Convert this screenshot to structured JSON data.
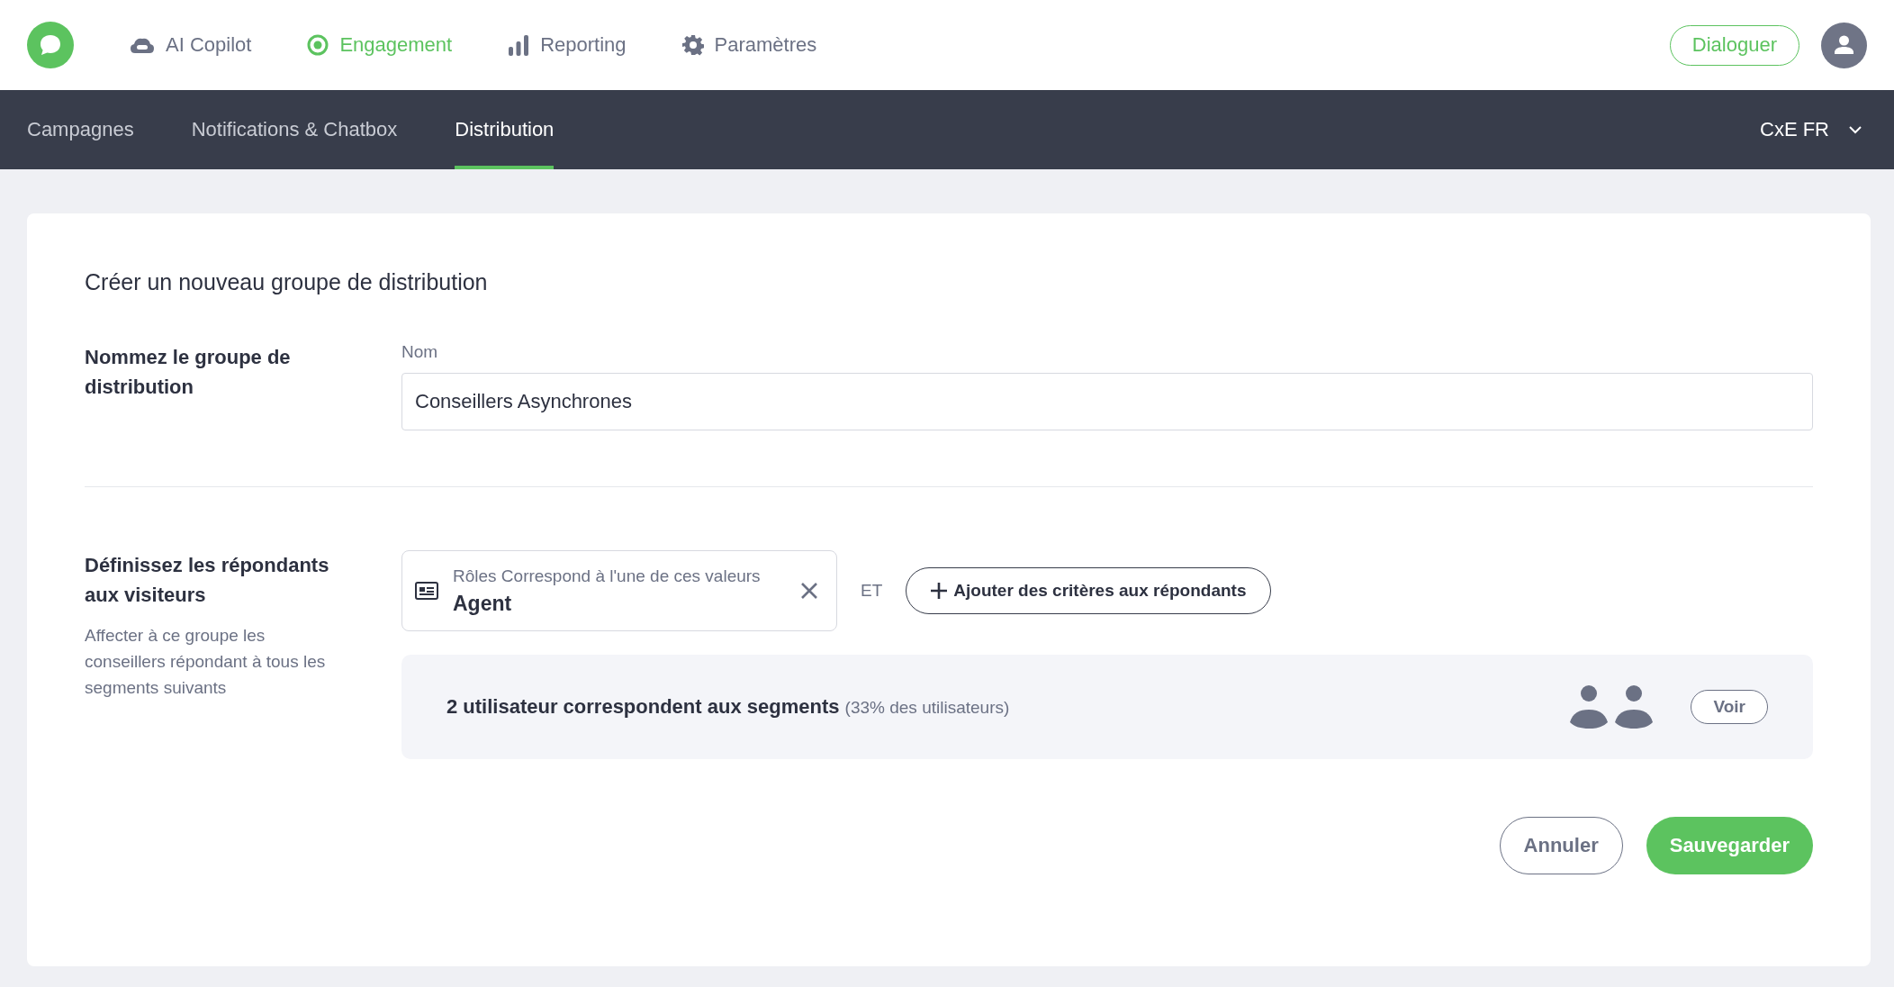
{
  "top_nav": {
    "items": [
      {
        "kind": "copilot",
        "label": "AI Copilot",
        "selected": false
      },
      {
        "kind": "engagement",
        "label": "Engagement",
        "selected": true
      },
      {
        "kind": "reporting",
        "label": "Reporting",
        "selected": false
      },
      {
        "kind": "settings",
        "label": "Paramètres",
        "selected": false
      }
    ],
    "cta": "Dialoguer"
  },
  "sub_nav": {
    "tabs": [
      {
        "label": "Campagnes",
        "selected": false
      },
      {
        "label": "Notifications & Chatbox",
        "selected": false
      },
      {
        "label": "Distribution",
        "selected": true
      }
    ],
    "workspace": "CxE FR"
  },
  "form": {
    "title": "Créer un nouveau groupe de distribution",
    "name_section": {
      "heading": "Nommez le groupe de distribution",
      "field_label": "Nom",
      "value": "Conseillers Asynchrones"
    },
    "respondents_section": {
      "heading": "Définissez les répondants aux visiteurs",
      "description": "Affecter à ce groupe les conseillers répondant à tous les segments suivants",
      "criterion": {
        "label": "Rôles Correspond à l'une de ces valeurs",
        "value": "Agent"
      },
      "connector": "ET",
      "add_button": "Ajouter des critères aux répondants",
      "summary": {
        "count_text": "2 utilisateur correspondent aux segments",
        "share_text": "(33% des utilisateurs)",
        "view_button": "Voir"
      }
    },
    "buttons": {
      "cancel": "Annuler",
      "save": "Sauvegarder"
    }
  }
}
